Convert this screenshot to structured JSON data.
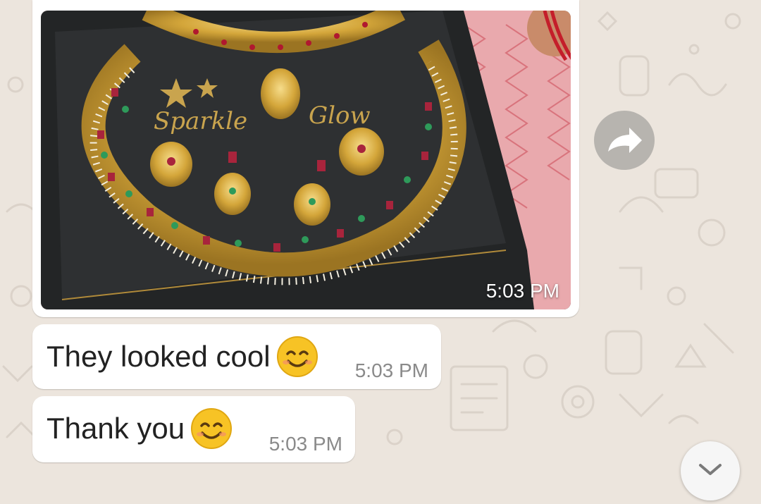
{
  "chat": {
    "messages": [
      {
        "type": "image",
        "caption_lines": [
          "Sparkle",
          "Glow"
        ],
        "time": "5:03 PM"
      },
      {
        "type": "text",
        "text": "They looked cool",
        "time": "5:03 PM"
      },
      {
        "type": "text",
        "text": "Thank you",
        "time": "5:03 PM"
      }
    ]
  },
  "icons": {
    "forward": "forward-arrow-icon",
    "scroll_down": "chevron-down-icon",
    "emoji": "smiling-face-emoji"
  },
  "colors": {
    "background": "#ece5dd",
    "bubble": "#ffffff",
    "timestamp": "#8a8a8a",
    "accent_gold": "#d4af37"
  }
}
